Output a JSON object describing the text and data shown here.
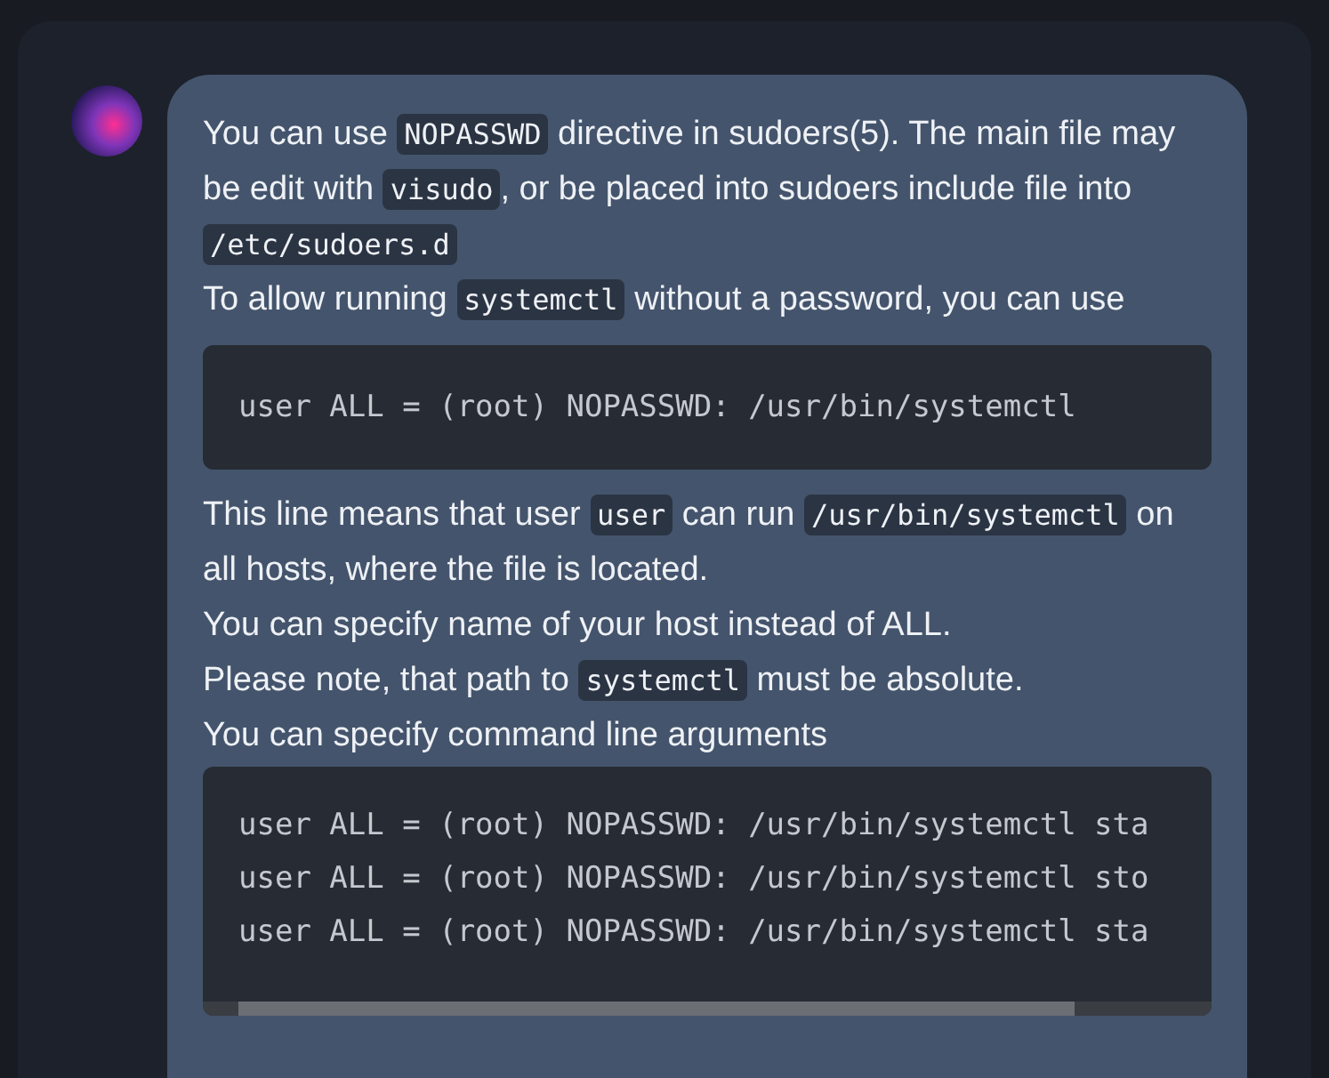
{
  "message": {
    "blocks": [
      {
        "kind": "paragraph",
        "lines": [
          [
            {
              "kind": "text",
              "text": "You can use "
            },
            {
              "kind": "code",
              "text": "NOPASSWD"
            },
            {
              "kind": "text",
              "text": " directive in sudoers(5). The main file may be edit with "
            },
            {
              "kind": "code",
              "text": "visudo"
            },
            {
              "kind": "text",
              "text": ", or be placed into sudoers include file into "
            },
            {
              "kind": "code",
              "text": "/etc/sudoers.d"
            }
          ],
          [
            {
              "kind": "text",
              "text": "To allow running "
            },
            {
              "kind": "code",
              "text": "systemctl"
            },
            {
              "kind": "text",
              "text": " without a password, you can use"
            }
          ]
        ]
      },
      {
        "kind": "code_block",
        "lines": [
          "user ALL = (root) NOPASSWD: /usr/bin/systemctl"
        ]
      },
      {
        "kind": "paragraph",
        "lines": [
          [
            {
              "kind": "text",
              "text": "This line means that user "
            },
            {
              "kind": "code",
              "text": "user"
            },
            {
              "kind": "text",
              "text": " can run "
            },
            {
              "kind": "code",
              "text": "/usr/bin/systemctl"
            },
            {
              "kind": "text",
              "text": " on all hosts, where the file is located."
            }
          ],
          [
            {
              "kind": "text",
              "text": "You can specify name of your host instead of ALL."
            }
          ],
          [
            {
              "kind": "text",
              "text": "Please note, that path to "
            },
            {
              "kind": "code",
              "text": "systemctl"
            },
            {
              "kind": "text",
              "text": " must be absolute."
            }
          ],
          [
            {
              "kind": "text",
              "text": "You can specify command line arguments"
            }
          ]
        ]
      },
      {
        "kind": "code_block",
        "lines": [
          "user ALL = (root) NOPASSWD: /usr/bin/systemctl sta",
          "user ALL = (root) NOPASSWD: /usr/bin/systemctl sto",
          "user ALL = (root) NOPASSWD: /usr/bin/systemctl sta"
        ]
      }
    ]
  }
}
